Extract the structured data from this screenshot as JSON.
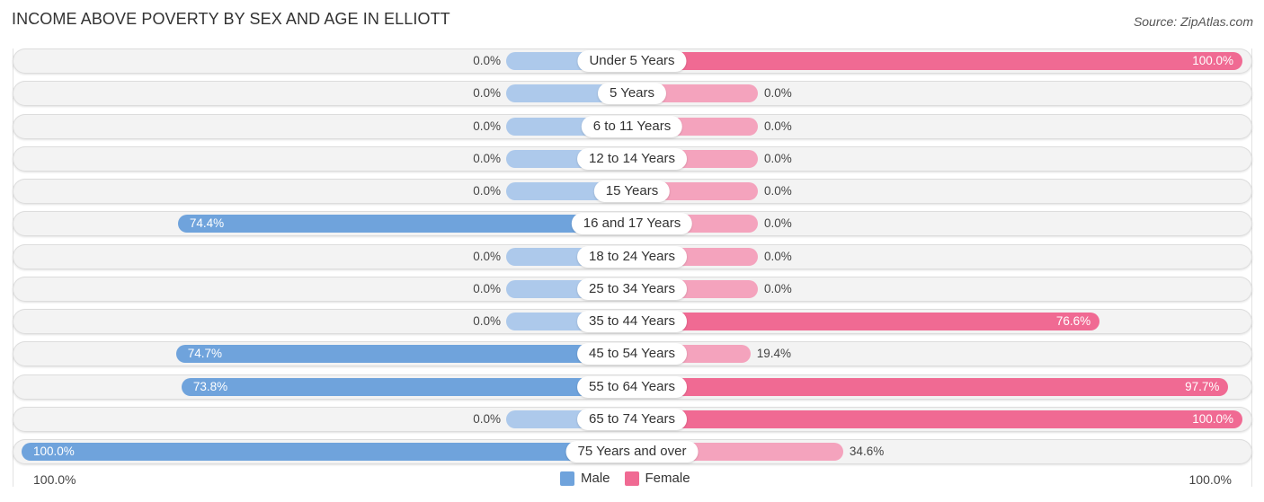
{
  "title": "INCOME ABOVE POVERTY BY SEX AND AGE IN ELLIOTT",
  "source": "Source: ZipAtlas.com",
  "chart_data": {
    "type": "bar",
    "orientation": "horizontal-diverging",
    "title": "INCOME ABOVE POVERTY BY SEX AND AGE IN ELLIOTT",
    "categories": [
      "Under 5 Years",
      "5 Years",
      "6 to 11 Years",
      "12 to 14 Years",
      "15 Years",
      "16 and 17 Years",
      "18 to 24 Years",
      "25 to 34 Years",
      "35 to 44 Years",
      "45 to 54 Years",
      "55 to 64 Years",
      "65 to 74 Years",
      "75 Years and over"
    ],
    "series": [
      {
        "name": "Male",
        "color": "#6fa3dc",
        "values": [
          0.0,
          0.0,
          0.0,
          0.0,
          0.0,
          74.4,
          0.0,
          0.0,
          0.0,
          74.7,
          73.8,
          0.0,
          100.0
        ],
        "labels": [
          "0.0%",
          "0.0%",
          "0.0%",
          "0.0%",
          "0.0%",
          "74.4%",
          "0.0%",
          "0.0%",
          "0.0%",
          "74.7%",
          "73.8%",
          "0.0%",
          "100.0%"
        ]
      },
      {
        "name": "Female",
        "color": "#f06a93",
        "values": [
          100.0,
          0.0,
          0.0,
          0.0,
          0.0,
          0.0,
          0.0,
          0.0,
          76.6,
          19.4,
          97.7,
          100.0,
          34.6
        ],
        "labels": [
          "100.0%",
          "0.0%",
          "0.0%",
          "0.0%",
          "0.0%",
          "0.0%",
          "0.0%",
          "0.0%",
          "76.6%",
          "19.4%",
          "97.7%",
          "100.0%",
          "34.6%"
        ]
      }
    ],
    "xlim": [
      -100,
      100
    ],
    "axis_labels": {
      "left": "100.0%",
      "right": "100.0%"
    },
    "legend": {
      "position": "bottom-center",
      "entries": [
        "Male",
        "Female"
      ]
    },
    "grid": false
  }
}
